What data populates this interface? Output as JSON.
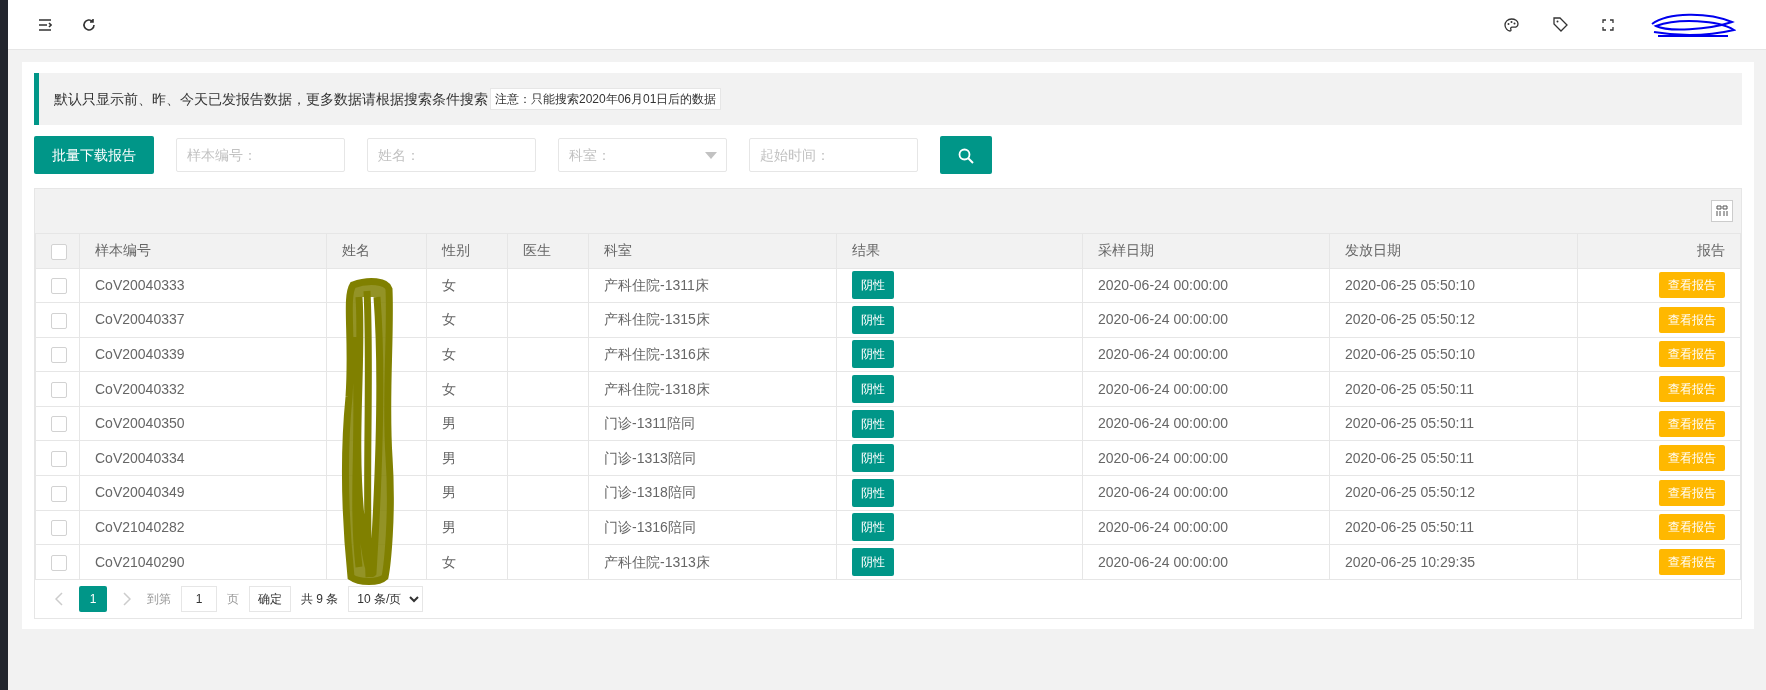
{
  "notice": {
    "text": "默认只显示前、昨、今天已发报告数据，更多数据请根据搜索条件搜索",
    "note": "注意：只能搜索2020年06月01日后的数据"
  },
  "search": {
    "button": "批量下载报告",
    "fields": [
      {
        "kind": "input",
        "placeholder": "样本编号："
      },
      {
        "kind": "input",
        "placeholder": "姓名："
      },
      {
        "kind": "select",
        "placeholder": "科室："
      },
      {
        "kind": "input",
        "placeholder": "起始时间："
      }
    ]
  },
  "table": {
    "header_checked": false,
    "columns": [
      "样本编号",
      "姓名",
      "性别",
      "医生",
      "科室",
      "结果",
      "采样日期",
      "发放日期",
      "报告"
    ],
    "rows": [
      {
        "checked": false,
        "id": "CoV20040333",
        "sex": "女",
        "dept": "产科住院-1311床",
        "result": "阴性",
        "sampled": "2020-06-24 00:00:00",
        "issued": "2020-06-25 05:50:10",
        "report": "查看报告"
      },
      {
        "checked": false,
        "id": "CoV20040337",
        "sex": "女",
        "dept": "产科住院-1315床",
        "result": "阴性",
        "sampled": "2020-06-24 00:00:00",
        "issued": "2020-06-25 05:50:12",
        "report": "查看报告"
      },
      {
        "checked": false,
        "id": "CoV20040339",
        "sex": "女",
        "dept": "产科住院-1316床",
        "result": "阴性",
        "sampled": "2020-06-24 00:00:00",
        "issued": "2020-06-25 05:50:10",
        "report": "查看报告"
      },
      {
        "checked": false,
        "id": "CoV20040332",
        "sex": "女",
        "dept": "产科住院-1318床",
        "result": "阴性",
        "sampled": "2020-06-24 00:00:00",
        "issued": "2020-06-25 05:50:11",
        "report": "查看报告"
      },
      {
        "checked": false,
        "id": "CoV20040350",
        "sex": "男",
        "dept": "门诊-1311陪同",
        "result": "阴性",
        "sampled": "2020-06-24 00:00:00",
        "issued": "2020-06-25 05:50:11",
        "report": "查看报告"
      },
      {
        "checked": false,
        "id": "CoV20040334",
        "sex": "男",
        "dept": "门诊-1313陪同",
        "result": "阴性",
        "sampled": "2020-06-24 00:00:00",
        "issued": "2020-06-25 05:50:11",
        "report": "查看报告"
      },
      {
        "checked": false,
        "id": "CoV20040349",
        "sex": "男",
        "dept": "门诊-1318陪同",
        "result": "阴性",
        "sampled": "2020-06-24 00:00:00",
        "issued": "2020-06-25 05:50:12",
        "report": "查看报告"
      },
      {
        "checked": false,
        "id": "CoV21040282",
        "sex": "男",
        "dept": "门诊-1316陪同",
        "result": "阴性",
        "sampled": "2020-06-24 00:00:00",
        "issued": "2020-06-25 05:50:11",
        "report": "查看报告"
      },
      {
        "checked": false,
        "id": "CoV21040290",
        "sex": "女",
        "dept": "产科住院-1313床",
        "result": "阴性",
        "sampled": "2020-06-24 00:00:00",
        "issued": "2020-06-25 10:29:35",
        "report": "查看报告"
      }
    ]
  },
  "pager": {
    "pages": [
      {
        "label": "1",
        "selected": true
      }
    ],
    "goto_label": "到第",
    "goto_value": "1",
    "page_label": "页",
    "confirm": "确定",
    "total": "共 9 条",
    "page_size": "10 条/页"
  }
}
